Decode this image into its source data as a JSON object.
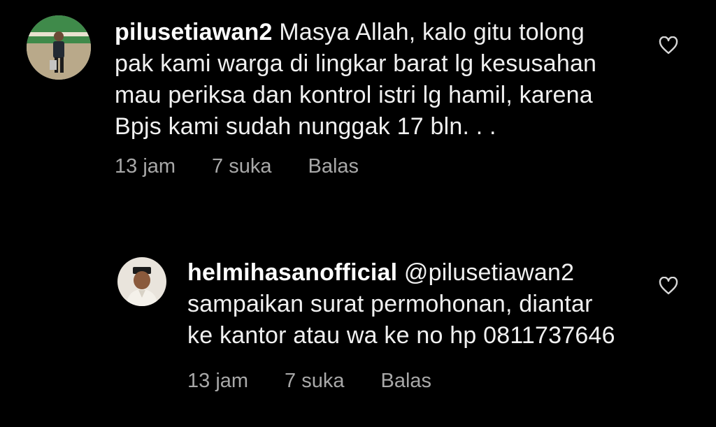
{
  "comments": [
    {
      "username": "pilusetiawan2",
      "text": "Masya Allah,  kalo gitu tolong pak kami warga di lingkar barat lg kesusahan mau periksa dan kontrol istri lg hamil, karena Bpjs kami sudah nunggak 17 bln. . .",
      "time": "13 jam",
      "likes": "7 suka",
      "reply": "Balas",
      "like_icon": "heart-outline-icon"
    },
    {
      "username": "helmihasanofficial",
      "text": "@pilusetiawan2 sampaikan surat permohonan, diantar ke kantor atau wa ke no hp 0811737646",
      "time": "13 jam",
      "likes": "7 suka",
      "reply": "Balas",
      "like_icon": "heart-outline-icon"
    }
  ],
  "colors": {
    "background": "#000000",
    "text": "#f0f0f0",
    "meta": "#a8a8a8"
  }
}
